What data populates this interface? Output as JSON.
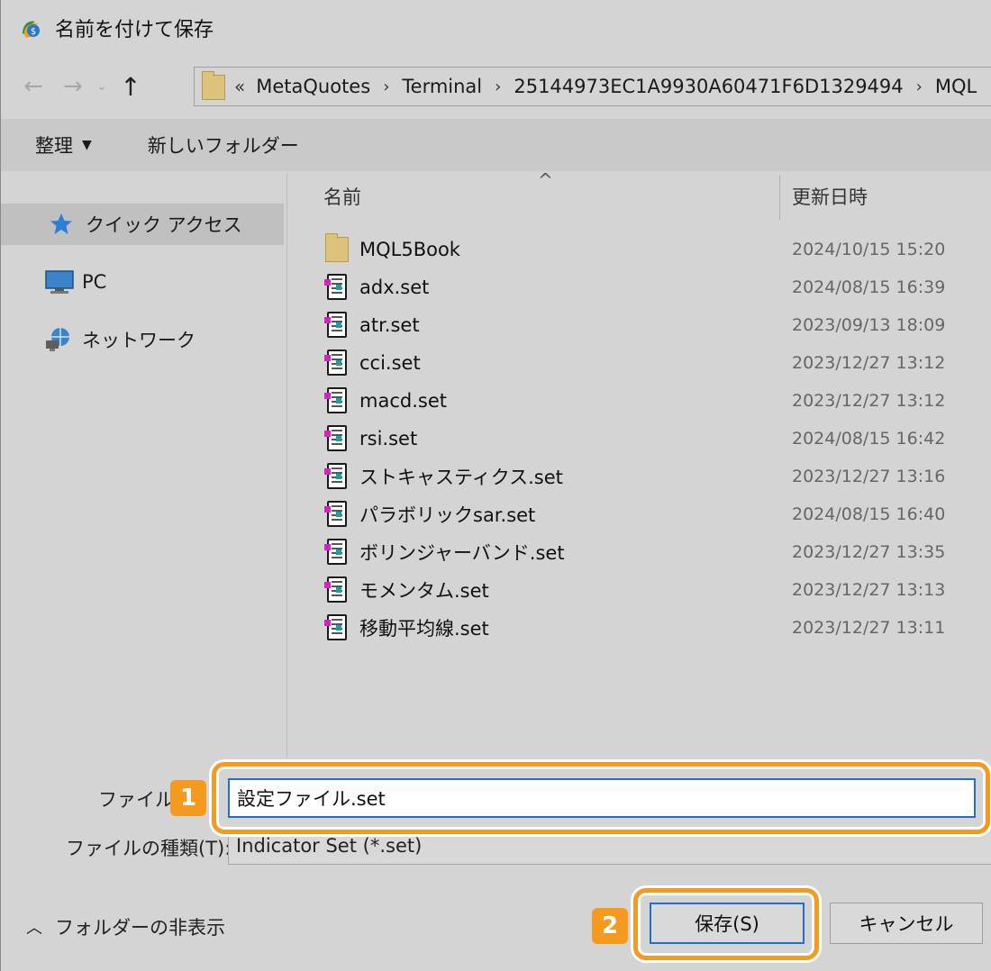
{
  "window": {
    "title": "名前を付けて保存"
  },
  "nav": {
    "back_icon": "back-arrow-icon",
    "forward_icon": "forward-arrow-icon",
    "recent_icon": "chevron-down-icon",
    "up_icon": "up-arrow-icon"
  },
  "address": {
    "overflow": "«",
    "crumbs": [
      "MetaQuotes",
      "Terminal",
      "25144973EC1A9930A60471F6D1329494",
      "MQL"
    ]
  },
  "toolbar": {
    "organize": "整理",
    "new_folder": "新しいフォルダー"
  },
  "sidebar": {
    "items": [
      {
        "label": "クイック アクセス",
        "icon": "star-icon",
        "selected": true
      },
      {
        "label": "PC",
        "icon": "pc-icon",
        "selected": false
      },
      {
        "label": "ネットワーク",
        "icon": "network-icon",
        "selected": false
      }
    ]
  },
  "filelist": {
    "columns": {
      "name": "名前",
      "modified": "更新日時"
    },
    "rows": [
      {
        "name": "MQL5Book",
        "date": "2024/10/15 15:20",
        "type": "folder"
      },
      {
        "name": "adx.set",
        "date": "2024/08/15 16:39",
        "type": "set"
      },
      {
        "name": "atr.set",
        "date": "2023/09/13 18:09",
        "type": "set"
      },
      {
        "name": "cci.set",
        "date": "2023/12/27 13:12",
        "type": "set"
      },
      {
        "name": "macd.set",
        "date": "2023/12/27 13:12",
        "type": "set"
      },
      {
        "name": "rsi.set",
        "date": "2024/08/15 16:42",
        "type": "set"
      },
      {
        "name": "ストキャスティクス.set",
        "date": "2023/12/27 13:16",
        "type": "set"
      },
      {
        "name": "パラボリックsar.set",
        "date": "2024/08/15 16:40",
        "type": "set"
      },
      {
        "name": "ボリンジャーバンド.set",
        "date": "2023/12/27 13:35",
        "type": "set"
      },
      {
        "name": "モメンタム.set",
        "date": "2023/12/27 13:13",
        "type": "set"
      },
      {
        "name": "移動平均線.set",
        "date": "2023/12/27 13:11",
        "type": "set"
      }
    ]
  },
  "form": {
    "filename_label": "ファイル名",
    "filename_value": "設定ファイル.set",
    "filetype_label": "ファイルの種類(T):",
    "filetype_value": "Indicator Set (*.set)"
  },
  "buttons": {
    "save": "保存(S)",
    "cancel": "キャンセル",
    "hide_folders": "フォルダーの非表示"
  },
  "callouts": {
    "one": "1",
    "two": "2",
    "color": "#f39a1f"
  },
  "colors": {
    "accent": "#1f6fd1",
    "callout": "#f39a1f"
  }
}
